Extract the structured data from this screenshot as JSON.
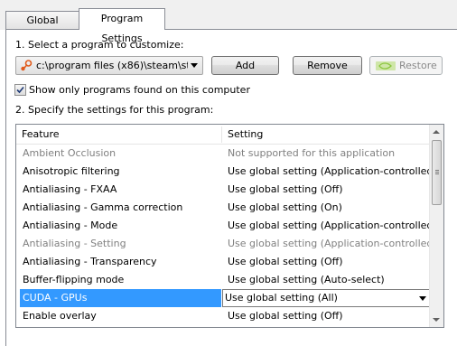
{
  "tabs": [
    {
      "label": "Global Settings"
    },
    {
      "label": "Program Settings"
    }
  ],
  "step1": {
    "label": "1. Select a program to customize:",
    "program_value": "c:\\program files (x86)\\steam\\st...",
    "add_label": "Add",
    "remove_label": "Remove",
    "restore_label": "Restore"
  },
  "filter": {
    "label": "Show only programs found on this computer",
    "checked": true
  },
  "step2": {
    "label": "2. Specify the settings for this program:"
  },
  "table": {
    "headers": {
      "feature": "Feature",
      "setting": "Setting"
    },
    "rows": [
      {
        "feature": "Ambient Occlusion",
        "setting": "Not supported for this application",
        "dim": true
      },
      {
        "feature": "Anisotropic filtering",
        "setting": "Use global setting (Application-controlled)"
      },
      {
        "feature": "Antialiasing - FXAA",
        "setting": "Use global setting (Off)"
      },
      {
        "feature": "Antialiasing - Gamma correction",
        "setting": "Use global setting (On)"
      },
      {
        "feature": "Antialiasing - Mode",
        "setting": "Use global setting (Application-controlled)"
      },
      {
        "feature": "Antialiasing - Setting",
        "setting": "Use global setting (Application-controlled)",
        "dim": true
      },
      {
        "feature": "Antialiasing - Transparency",
        "setting": "Use global setting (Off)"
      },
      {
        "feature": "Buffer-flipping mode",
        "setting": "Use global setting (Auto-select)"
      },
      {
        "feature": "CUDA - GPUs",
        "setting": "Use global setting (All)",
        "selected": true
      },
      {
        "feature": "Enable overlay",
        "setting": "Use global setting (Off)"
      }
    ]
  },
  "colors": {
    "selection": "#3399ff",
    "dim_text": "#808080",
    "nvidia_green": "#76b900"
  },
  "icons": {
    "program": "steam-icon",
    "restore": "nvidia-icon",
    "dropdown": "chevron-down-icon",
    "checkbox": "checkmark-icon"
  }
}
